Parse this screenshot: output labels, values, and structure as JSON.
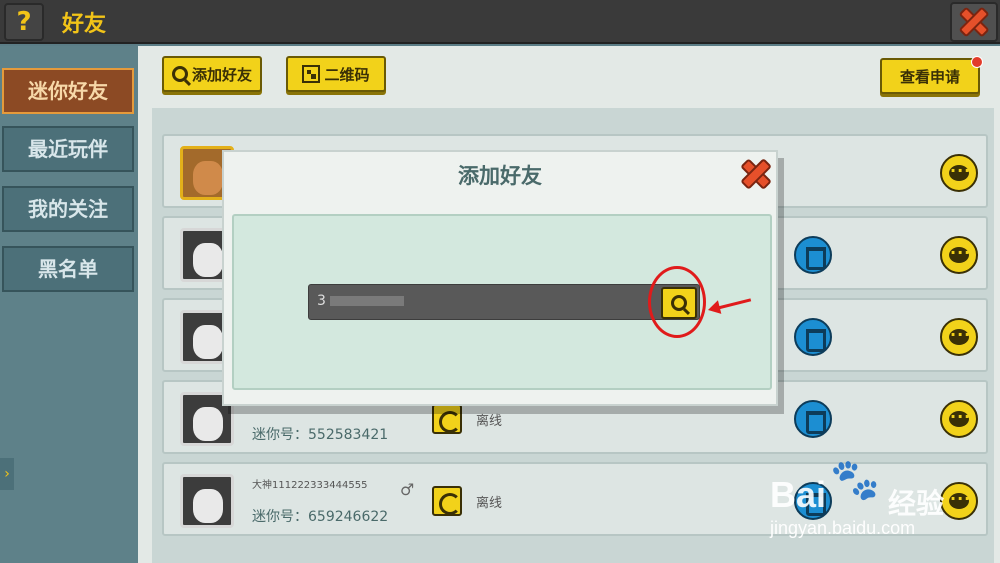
{
  "topbar": {
    "help_label": "?",
    "title": "好友"
  },
  "sidebar": {
    "items": [
      {
        "label": "迷你好友",
        "active": true
      },
      {
        "label": "最近玩伴",
        "active": false
      },
      {
        "label": "我的关注",
        "active": false
      },
      {
        "label": "黑名单",
        "active": false
      }
    ],
    "toggle": "›"
  },
  "toolbar": {
    "add_friend_label": "添加好友",
    "qr_label": "二维码",
    "view_requests_label": "查看申请"
  },
  "friends": [
    {
      "nickname": "",
      "mini_no_label": "",
      "gender": "",
      "status": "",
      "avatar": "gold"
    },
    {
      "nickname": "",
      "mini_no_label": "",
      "gender": "",
      "status": "",
      "avatar": "gray"
    },
    {
      "nickname": "",
      "mini_no_label": "",
      "gender": "",
      "status": "",
      "avatar": "gray"
    },
    {
      "nickname": "",
      "mini_no_label": "迷你号：552583421",
      "gender": "",
      "status": "离线",
      "avatar": "gray"
    },
    {
      "nickname": "大神111222333444555",
      "mini_no_label": "迷你号：659246622",
      "gender": "♂",
      "status": "离线",
      "avatar": "gray"
    }
  ],
  "modal": {
    "title": "添加好友",
    "search_value": "3"
  },
  "watermark": {
    "brand": "Bai",
    "brand2": "经验",
    "url": "jingyan.baidu.com"
  },
  "colors": {
    "accent_yellow": "#f2d21a",
    "delete_blue": "#1c8ed2",
    "annotation_red": "#e01b1b",
    "active_tab": "#8c4a24"
  }
}
